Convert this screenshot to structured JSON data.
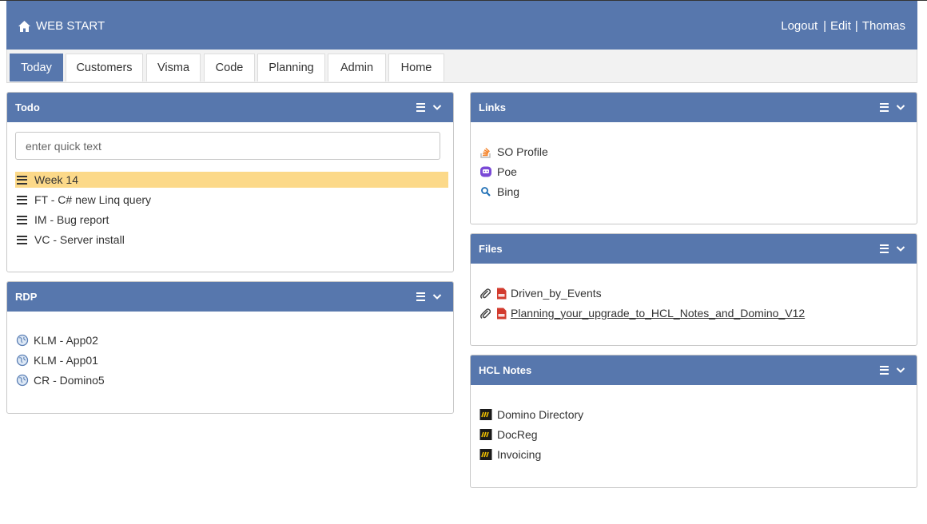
{
  "header": {
    "brand": "WEB START",
    "links": [
      "Logout",
      "Edit",
      "Thomas"
    ],
    "separator": "|"
  },
  "tabs": [
    "Today",
    "Customers",
    "Visma",
    "Code",
    "Planning",
    "Admin",
    "Home"
  ],
  "active_tab": "Today",
  "colors": {
    "header": "#5777ad",
    "highlight": "#fcd989"
  },
  "todo": {
    "title": "Todo",
    "input_placeholder": "enter quick text",
    "items": [
      "Week 14",
      "FT - C# new Linq query",
      "IM - Bug report",
      "VC - Server install"
    ],
    "highlighted_item": "Week 14"
  },
  "rdp": {
    "title": "RDP",
    "items": [
      "KLM - App02",
      "KLM - App01",
      "CR - Domino5"
    ]
  },
  "links": {
    "title": "Links",
    "items": [
      {
        "label": "SO Profile",
        "icon": "stackoverflow-icon"
      },
      {
        "label": "Poe",
        "icon": "poe-icon"
      },
      {
        "label": "Bing",
        "icon": "bing-search-icon"
      }
    ]
  },
  "files": {
    "title": "Files",
    "items": [
      "Driven_by_Events",
      "Planning_your_upgrade_to_HCL_Notes_and_Domino_V12"
    ]
  },
  "hcl": {
    "title": "HCL Notes",
    "items": [
      "Domino Directory",
      "DocReg",
      "Invoicing"
    ]
  }
}
